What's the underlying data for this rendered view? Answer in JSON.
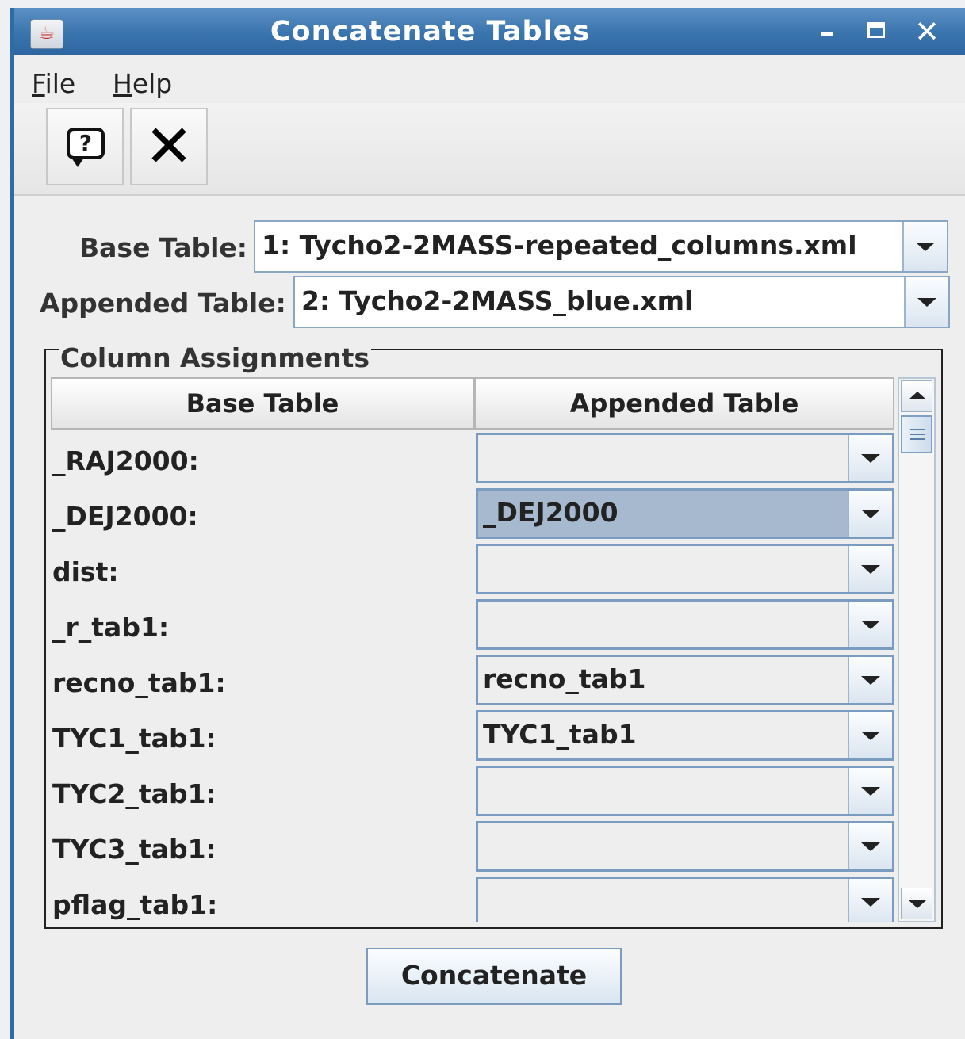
{
  "window": {
    "title": "Concatenate Tables",
    "minimize_icon": "minimize-icon",
    "maximize_icon": "maximize-icon",
    "close_icon": "close-icon"
  },
  "menu": {
    "items": [
      {
        "label": "File",
        "mnemonic": "F"
      },
      {
        "label": "Help",
        "mnemonic": "H"
      }
    ]
  },
  "toolbar": {
    "buttons": [
      {
        "icon": "help-icon",
        "glyph": "?"
      },
      {
        "icon": "close-icon",
        "glyph": "✕"
      }
    ]
  },
  "form": {
    "base_label": "Base Table:",
    "base_value": "1: Tycho2-2MASS-repeated_columns.xml",
    "appended_label": "Appended Table:",
    "appended_value": "2: Tycho2-2MASS_blue.xml"
  },
  "assignments": {
    "title": "Column Assignments",
    "columns": [
      "Base Table",
      "Appended Table"
    ],
    "rows": [
      {
        "base": "_RAJ2000:",
        "appended": "",
        "selected": false
      },
      {
        "base": "_DEJ2000:",
        "appended": "_DEJ2000",
        "selected": true
      },
      {
        "base": "dist:",
        "appended": "",
        "selected": false
      },
      {
        "base": "_r_tab1:",
        "appended": "",
        "selected": false
      },
      {
        "base": "recno_tab1:",
        "appended": "recno_tab1",
        "selected": false
      },
      {
        "base": "TYC1_tab1:",
        "appended": "TYC1_tab1",
        "selected": false
      },
      {
        "base": "TYC2_tab1:",
        "appended": "",
        "selected": false
      },
      {
        "base": "TYC3_tab1:",
        "appended": "",
        "selected": false
      },
      {
        "base": "pflag_tab1:",
        "appended": "",
        "selected": false
      }
    ]
  },
  "actions": {
    "concatenate_label": "Concatenate"
  }
}
